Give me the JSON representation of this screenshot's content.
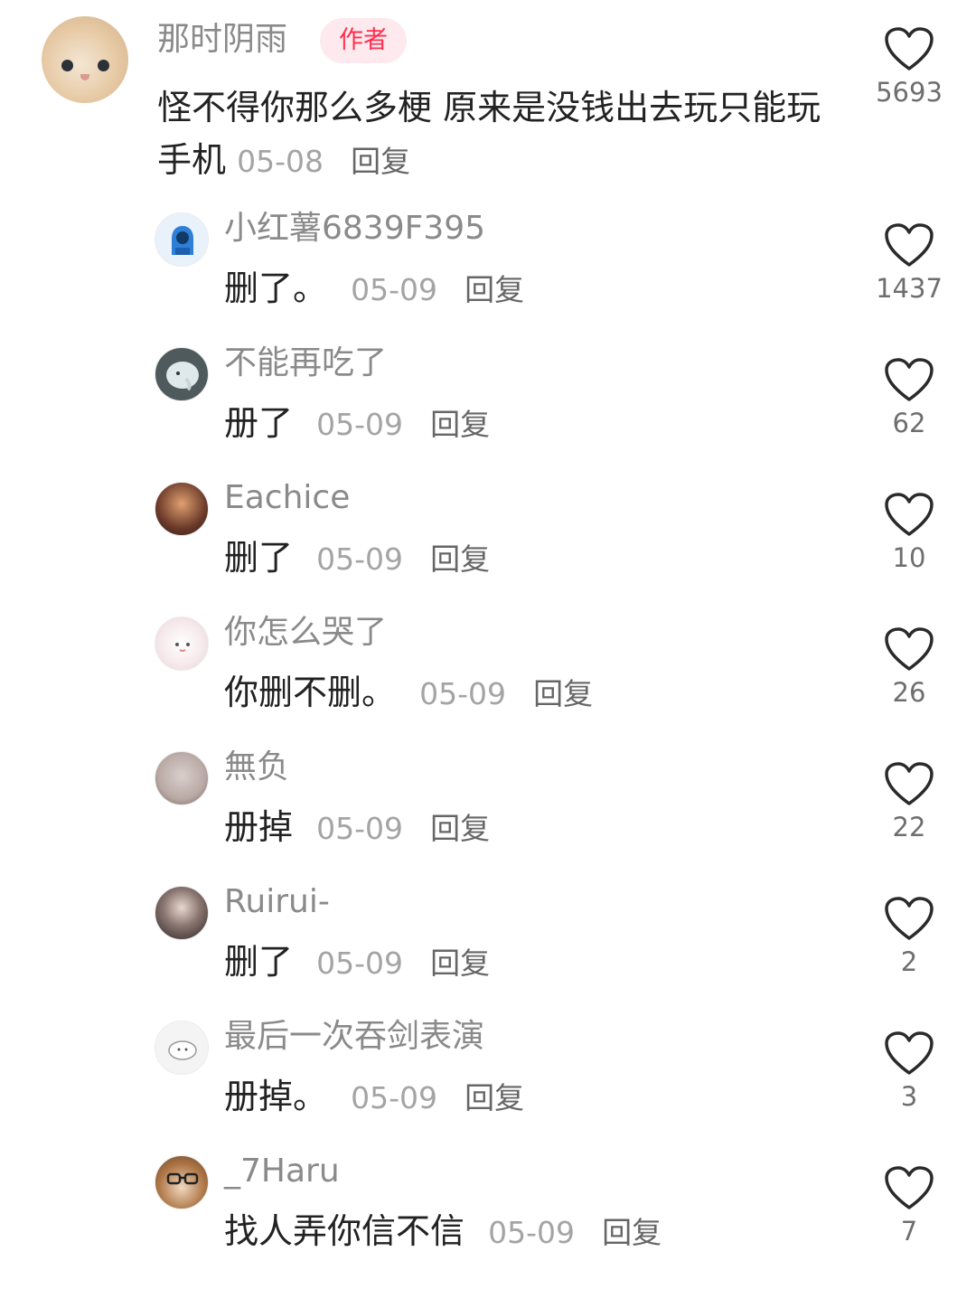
{
  "main_comment": {
    "username": "那时阴雨",
    "badge": "作者",
    "text": "怪不得你那么多梗 原来是没钱出去玩只能玩手机",
    "date": "05-08",
    "reply_label": "回复",
    "likes": "5693"
  },
  "replies": [
    {
      "username": "小红薯6839F395",
      "text": "删了。",
      "date": "05-09",
      "reply_label": "回复",
      "likes": "1437",
      "avatar_color": "#e9f1fb"
    },
    {
      "username": "不能再吃了",
      "text": "册了",
      "date": "05-09",
      "reply_label": "回复",
      "likes": "62",
      "avatar_color": "#4e5a5c"
    },
    {
      "username": "Eachice",
      "text": "删了",
      "date": "05-09",
      "reply_label": "回复",
      "likes": "10",
      "avatar_color": "#6b3a2a"
    },
    {
      "username": "你怎么哭了",
      "text": "你删不删。",
      "date": "05-09",
      "reply_label": "回复",
      "likes": "26",
      "avatar_color": "#f5e8ea"
    },
    {
      "username": "無负",
      "text": "册掉",
      "date": "05-09",
      "reply_label": "回复",
      "likes": "22",
      "avatar_color": "#b9a9a4"
    },
    {
      "username": "Ruirui-",
      "text": "删了",
      "date": "05-09",
      "reply_label": "回复",
      "likes": "2",
      "avatar_color": "#3a3434"
    },
    {
      "username": "最后一次吞剑表演",
      "text": "册掉。",
      "date": "05-09",
      "reply_label": "回复",
      "likes": "3",
      "avatar_color": "#f4f4f4"
    },
    {
      "username": "_7Haru",
      "text": "找人弄你信不信",
      "date": "05-09",
      "reply_label": "回复",
      "likes": "7",
      "avatar_color": "#b07848"
    }
  ]
}
